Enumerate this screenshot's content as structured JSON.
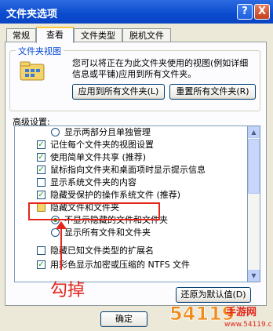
{
  "window": {
    "title": "文件夹选项",
    "help_glyph": "?",
    "close_glyph": "X"
  },
  "tabs": [
    {
      "label": "常规"
    },
    {
      "label": "查看"
    },
    {
      "label": "文件类型"
    },
    {
      "label": "脱机文件"
    }
  ],
  "folder_views": {
    "title": "文件夹视图",
    "description": "您可以将正在为此文件夹使用的视图(例如详细信息或平铺)应用到所有文件夹。",
    "apply_all_label": "应用到所有文件夹(L)",
    "reset_all_label": "重置所有文件夹(R)"
  },
  "advanced": {
    "label": "高级设置:",
    "items": [
      {
        "type": "radio",
        "checked": false,
        "text": "显示两部分且单独管理"
      },
      {
        "type": "checkbox",
        "checked": true,
        "text": "记住每个文件夹的视图设置"
      },
      {
        "type": "checkbox",
        "checked": true,
        "text": "使用简单文件共享 (推荐)"
      },
      {
        "type": "checkbox",
        "checked": true,
        "text": "鼠标指向文件夹和桌面项时显示提示信息"
      },
      {
        "type": "checkbox",
        "checked": false,
        "text": "显示系统文件夹的内容"
      },
      {
        "type": "checkbox",
        "checked": true,
        "text": "隐藏受保护的操作系统文件 (推荐)"
      },
      {
        "type": "folder",
        "checked": false,
        "text": "隐藏文件和文件夹"
      },
      {
        "type": "radio",
        "checked": true,
        "text": "不显示隐藏的文件和文件夹"
      },
      {
        "type": "radio",
        "checked": false,
        "text": "显示所有文件和文件夹"
      },
      {
        "type": "checkbox",
        "checked": false,
        "text": "隐藏已知文件类型的扩展名"
      },
      {
        "type": "checkbox",
        "checked": true,
        "text": "用彩色显示加密或压缩的 NTFS 文件"
      }
    ],
    "restore_defaults_label": "还原为默认值(D)"
  },
  "annotation": {
    "text": "勾掉",
    "color": "#e3261b"
  },
  "footer": {
    "ok_label": "确定"
  },
  "watermark": {
    "text": "54119手游网",
    "sub": "www.54119.cn"
  },
  "colors": {
    "title_bar": "#0a4bcf",
    "group_title": "#0046d5",
    "check": "#21a121",
    "annotation": "#e3261b"
  }
}
